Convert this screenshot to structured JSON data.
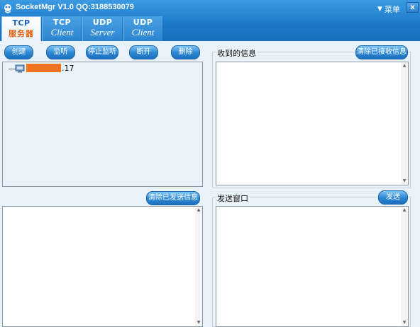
{
  "window": {
    "title": "SocketMgr V1.0  QQ:3188530079",
    "menu_label": "菜单",
    "close_label": "x"
  },
  "tabs": [
    {
      "line1": "TCP",
      "line2": "服务器",
      "active": true
    },
    {
      "line1": "TCP",
      "line2": "Client",
      "active": false
    },
    {
      "line1": "UDP",
      "line2": "Server",
      "active": false
    },
    {
      "line1": "UDP",
      "line2": "Client",
      "active": false
    }
  ],
  "toolbar": {
    "create": "创建",
    "listen": "监听",
    "stop_listen": "停止监听",
    "disconnect": "断开",
    "delete": "删除"
  },
  "connections": {
    "items": [
      {
        "label_suffix": ".17"
      }
    ]
  },
  "received": {
    "label": "收到的信息",
    "clear_button": "清除已接收信息",
    "text": ""
  },
  "sent_log": {
    "clear_button": "清除已发送信息",
    "text": ""
  },
  "send": {
    "label": "发送窗口",
    "send_button": "发送",
    "text": ""
  },
  "icons": {
    "app": "app-logo-icon",
    "tree_node": "network-computer-icon",
    "menu": "chevron-down-icon"
  },
  "colors": {
    "title_bar": "#1c78c9",
    "accent_orange": "#e2600c",
    "button": "#2c86d2"
  }
}
